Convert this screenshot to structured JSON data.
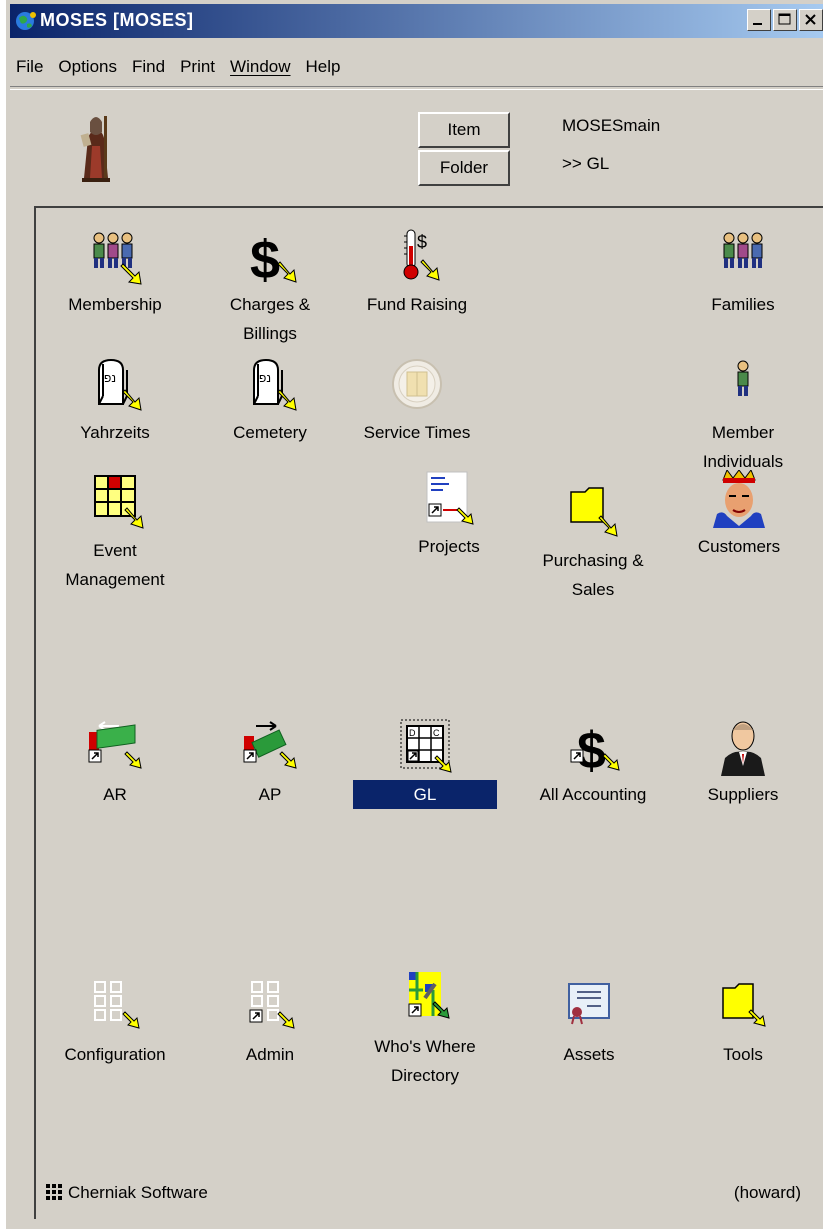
{
  "window": {
    "title": "MOSES  [MOSES]",
    "accent_color": "#0a246a"
  },
  "menu": [
    "File",
    "Options",
    "Find",
    "Print",
    "Window",
    "Help"
  ],
  "header": {
    "item_button": "Item",
    "folder_button": "Folder",
    "location": "MOSESmain",
    "path": ">> GL"
  },
  "tiles": {
    "membership": {
      "label": "Membership",
      "icon": "people-icon"
    },
    "charges": {
      "label": "Charges & Billings",
      "icon": "dollar-icon"
    },
    "fundraising": {
      "label": "Fund Raising",
      "icon": "thermometer-icon"
    },
    "families": {
      "label": "Families",
      "icon": "people-icon"
    },
    "yahrzeits": {
      "label": "Yahrzeits",
      "icon": "tombstone-icon"
    },
    "cemetery": {
      "label": "Cemetery",
      "icon": "tombstone-icon"
    },
    "service_times": {
      "label": "Service Times",
      "icon": "clock-icon"
    },
    "member_individuals": {
      "label": "Member Individuals",
      "icon": "person-icon"
    },
    "event_management": {
      "label": "Event Management",
      "icon": "calendar-icon"
    },
    "projects": {
      "label": "Projects",
      "icon": "document-icon"
    },
    "purchasing": {
      "label": "Purchasing & Sales",
      "icon": "folder-icon"
    },
    "customers": {
      "label": "Customers",
      "icon": "king-icon"
    },
    "ar": {
      "label": "AR",
      "icon": "money-in-icon"
    },
    "ap": {
      "label": "AP",
      "icon": "money-out-icon"
    },
    "gl": {
      "label": "GL",
      "icon": "ledger-icon"
    },
    "all_accounting": {
      "label": "All Accounting",
      "icon": "dollar-icon"
    },
    "suppliers": {
      "label": "Suppliers",
      "icon": "businessman-icon"
    },
    "configuration": {
      "label": "Configuration",
      "icon": "network-icon"
    },
    "admin": {
      "label": "Admin",
      "icon": "network-icon"
    },
    "whos_where": {
      "label": "Who's Where Directory",
      "icon": "map-icon"
    },
    "assets": {
      "label": "Assets",
      "icon": "certificate-icon"
    },
    "tools": {
      "label": "Tools",
      "icon": "folder-icon"
    }
  },
  "status": {
    "company": "Cherniak Software",
    "user": "(howard)"
  }
}
